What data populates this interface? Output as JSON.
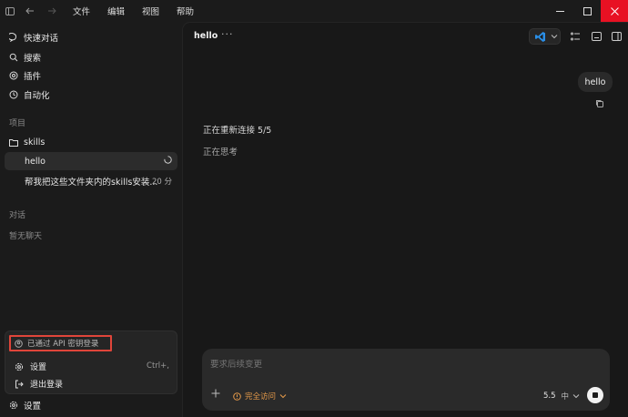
{
  "menu": [
    "文件",
    "编辑",
    "视图",
    "帮助"
  ],
  "sidebar": {
    "nav": [
      {
        "label": "快速对话",
        "icon": "chat-bubble-icon"
      },
      {
        "label": "搜索",
        "icon": "search-icon"
      },
      {
        "label": "插件",
        "icon": "plugin-icon"
      },
      {
        "label": "自动化",
        "icon": "clock-icon"
      }
    ],
    "projects_label": "项目",
    "project_folder": "skills",
    "threads": [
      {
        "title": "hello",
        "meta": ""
      },
      {
        "title": "帮我把这些文件夹内的skills安装...",
        "meta": "20 分"
      }
    ],
    "chats_label": "对话",
    "chats_empty": "暂无聊天",
    "popup": {
      "api_login": "已通过 API 密钥登录",
      "settings": "设置",
      "settings_shortcut": "Ctrl+,",
      "logout": "退出登录"
    },
    "bottom_settings": "设置"
  },
  "main": {
    "title": "hello",
    "more": "···",
    "user_message": "hello",
    "reconnect": "正在重新连接 5/5",
    "thinking": "正在思考",
    "composer": {
      "placeholder": "要求后续变更",
      "access": "完全访问",
      "model": "5.5",
      "level": "中"
    }
  },
  "colors": {
    "accent_orange": "#e59a4a",
    "close_red": "#e81123",
    "highlight_red": "#e0453a",
    "vscode_blue": "#2a8fe8"
  }
}
